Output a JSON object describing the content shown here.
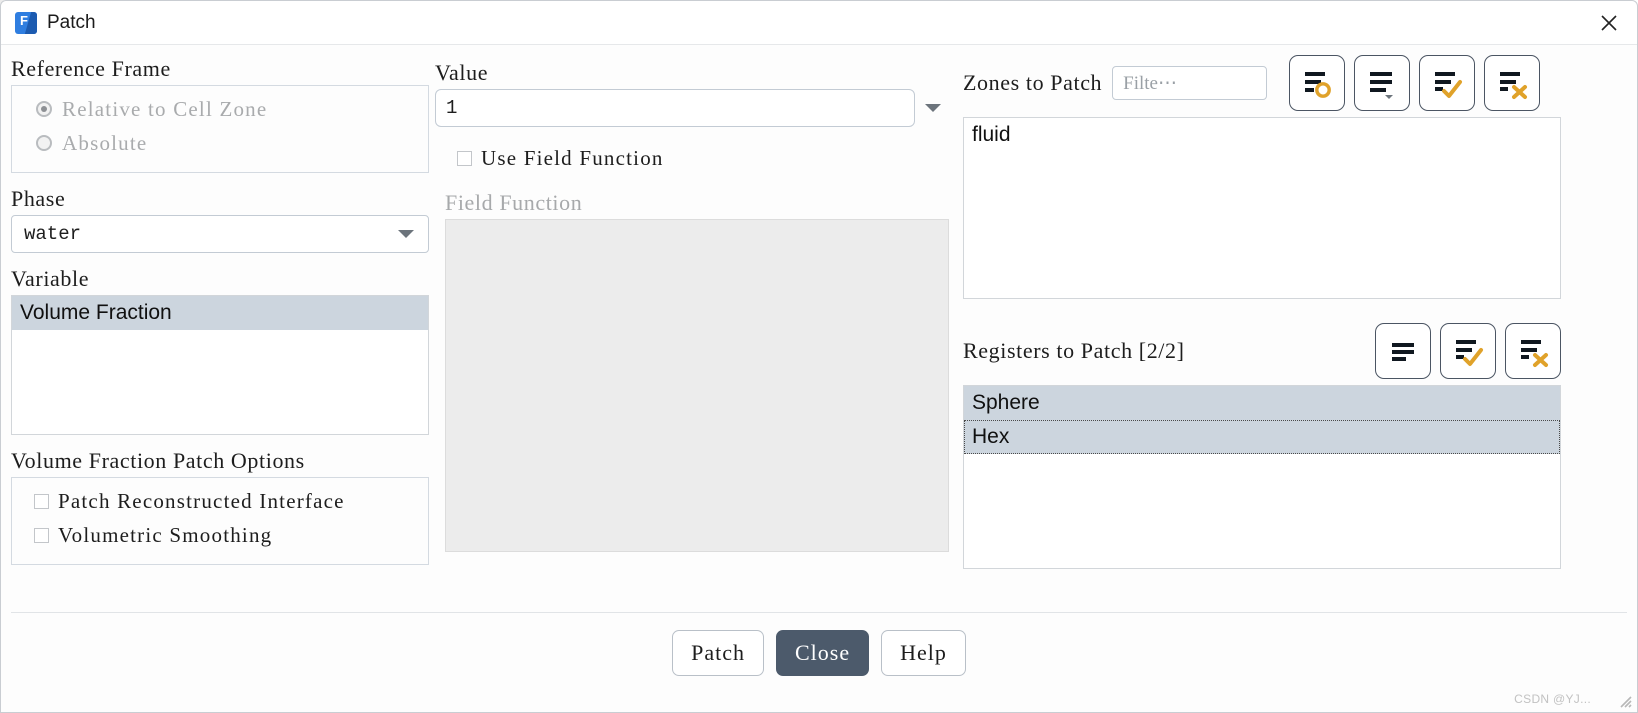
{
  "window": {
    "title": "Patch",
    "app_icon": "fluent-f-icon",
    "close_icon": "close-icon"
  },
  "reference_frame": {
    "label": "Reference Frame",
    "options": [
      {
        "label": "Relative to Cell Zone",
        "checked": true,
        "disabled": true
      },
      {
        "label": "Absolute",
        "checked": false,
        "disabled": true
      }
    ]
  },
  "phase": {
    "label": "Phase",
    "value": "water",
    "dropdown_icon": "chevron-down-icon"
  },
  "variable": {
    "label": "Variable",
    "items": [
      {
        "label": "Volume Fraction",
        "selected": true
      }
    ]
  },
  "patch_options": {
    "label": "Volume Fraction Patch Options",
    "items": [
      {
        "label": "Patch Reconstructed Interface",
        "checked": false
      },
      {
        "label": "Volumetric Smoothing",
        "checked": false
      }
    ]
  },
  "value": {
    "label": "Value",
    "text": "1",
    "placeholder": "",
    "dropdown_icon": "triangle-down-icon"
  },
  "use_field_function": {
    "label": "Use Field Function",
    "checked": false
  },
  "field_function": {
    "label": "Field Function",
    "disabled": true,
    "items": []
  },
  "zones": {
    "label": "Zones to Patch",
    "filter_placeholder": "Filte⋯",
    "filter_value": "",
    "toolbar": [
      {
        "name": "new-register-button",
        "icon": "list-circle-icon"
      },
      {
        "name": "list-options-button",
        "icon": "list-dropdown-icon"
      },
      {
        "name": "select-all-button",
        "icon": "list-check-icon"
      },
      {
        "name": "deselect-all-button",
        "icon": "list-x-icon"
      }
    ],
    "items": [
      {
        "label": "fluid",
        "selected": false
      }
    ]
  },
  "registers": {
    "label": "Registers to Patch [2/2]",
    "toolbar": [
      {
        "name": "list-options-button",
        "icon": "list-plain-icon"
      },
      {
        "name": "select-all-button",
        "icon": "list-check-icon"
      },
      {
        "name": "deselect-all-button",
        "icon": "list-x-icon"
      }
    ],
    "items": [
      {
        "label": "Sphere",
        "selected": true,
        "focused": false
      },
      {
        "label": "Hex",
        "selected": true,
        "focused": true
      }
    ]
  },
  "buttons": [
    {
      "label": "Patch",
      "primary": false,
      "name": "patch-button"
    },
    {
      "label": "Close",
      "primary": true,
      "name": "close-button"
    },
    {
      "label": "Help",
      "primary": false,
      "name": "help-button"
    }
  ],
  "watermark": "CSDN @YJ...",
  "colors": {
    "accent_orange": "#e0a22a",
    "primary_button": "#4c5a6b",
    "selection": "#ccd5de",
    "icon_dark": "#101820",
    "brand_blue": "#2f7ee0"
  }
}
